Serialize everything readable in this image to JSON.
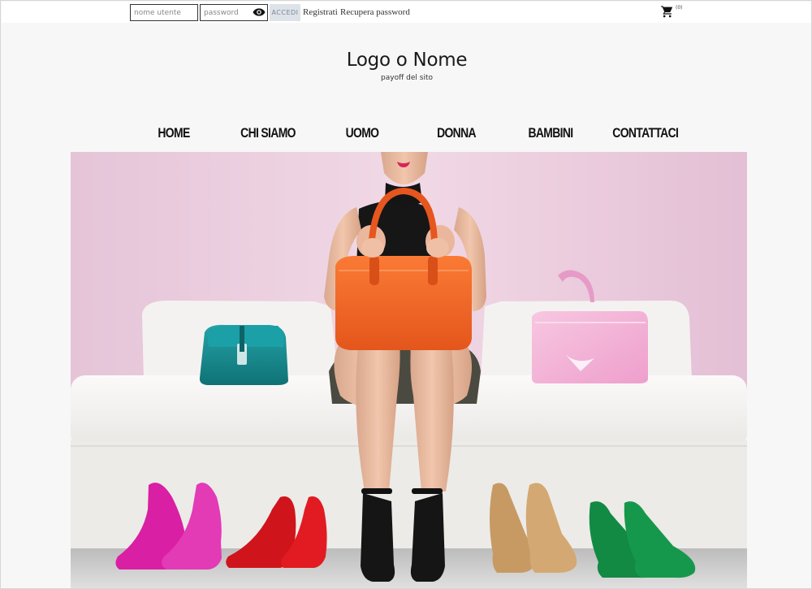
{
  "topbar": {
    "username_placeholder": "nome utente",
    "password_placeholder": "password",
    "show_password_icon": "eye-icon",
    "login_button": "ACCEDI",
    "register_link": "Registrati",
    "recover_link": "Recupera password",
    "cart_icon": "shopping-cart-icon",
    "cart_count": "(0)"
  },
  "header": {
    "logo": "Logo o Nome",
    "payoff": "payoff del sito"
  },
  "nav": {
    "items": [
      "HOME",
      "CHI SIAMO",
      "UOMO",
      "DONNA",
      "BAMBINI",
      "CONTATTACI"
    ]
  },
  "hero": {
    "image": "woman-with-handbags-and-shoes-photo",
    "colors": {
      "wall": "#eacbdd",
      "sofa": "#f2f1ef",
      "handbag_main": "#f26a2a",
      "handbag_left": "#1b8f93",
      "handbag_right": "#f3b8d8"
    }
  }
}
